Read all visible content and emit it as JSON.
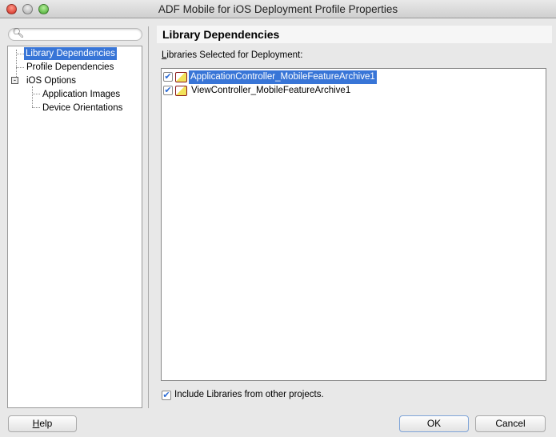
{
  "window": {
    "title": "ADF Mobile for iOS Deployment Profile Properties"
  },
  "search": {
    "placeholder": ""
  },
  "tree": {
    "items": [
      {
        "label": "Library Dependencies",
        "selected": true
      },
      {
        "label": "Profile Dependencies"
      },
      {
        "label": "iOS Options",
        "expanded": true
      },
      {
        "label": "Application Images"
      },
      {
        "label": "Device Orientations"
      }
    ]
  },
  "panel": {
    "title": "Library Dependencies",
    "list_label_mnemonic": "L",
    "list_label_rest": "ibraries Selected for Deployment:",
    "libraries": [
      {
        "name": "ApplicationController_MobileFeatureArchive1",
        "checked": true,
        "selected": true
      },
      {
        "name": "ViewController_MobileFeatureArchive1",
        "checked": true
      }
    ],
    "include_label": "Include Libraries from other projects.",
    "include_checked": true
  },
  "buttons": {
    "help_mnemonic": "H",
    "help_rest": "elp",
    "ok": "OK",
    "cancel": "Cancel"
  },
  "colors": {
    "selection": "#3875d7"
  }
}
